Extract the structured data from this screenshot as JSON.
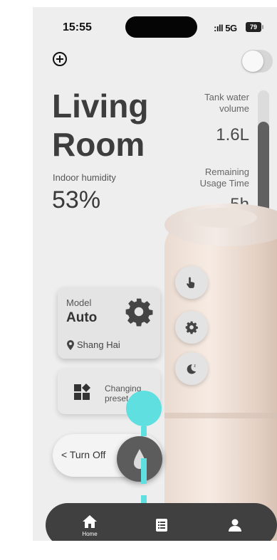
{
  "status_bar": {
    "time": "15:55",
    "signal": ":ıll 5G",
    "battery": "79"
  },
  "room": {
    "name_line1": "Living",
    "name_line2": "Room"
  },
  "humidity": {
    "label": "Indoor humidity",
    "value": "53%"
  },
  "tank": {
    "label": "Tank water volume",
    "value": "1.6L",
    "level_fraction": 0.75
  },
  "remaining": {
    "label": "Remaining Usage Time",
    "value": "5h"
  },
  "mode_card": {
    "label": "Model",
    "value": "Auto",
    "location": "Shang Hai"
  },
  "preset": {
    "line1": "Changing",
    "line2": "preset"
  },
  "power": {
    "label": "Turn Off"
  },
  "tabbar": {
    "home_label": "Home"
  },
  "colors": {
    "accent_touch": "#60dfe0",
    "tabbar": "#404040"
  }
}
